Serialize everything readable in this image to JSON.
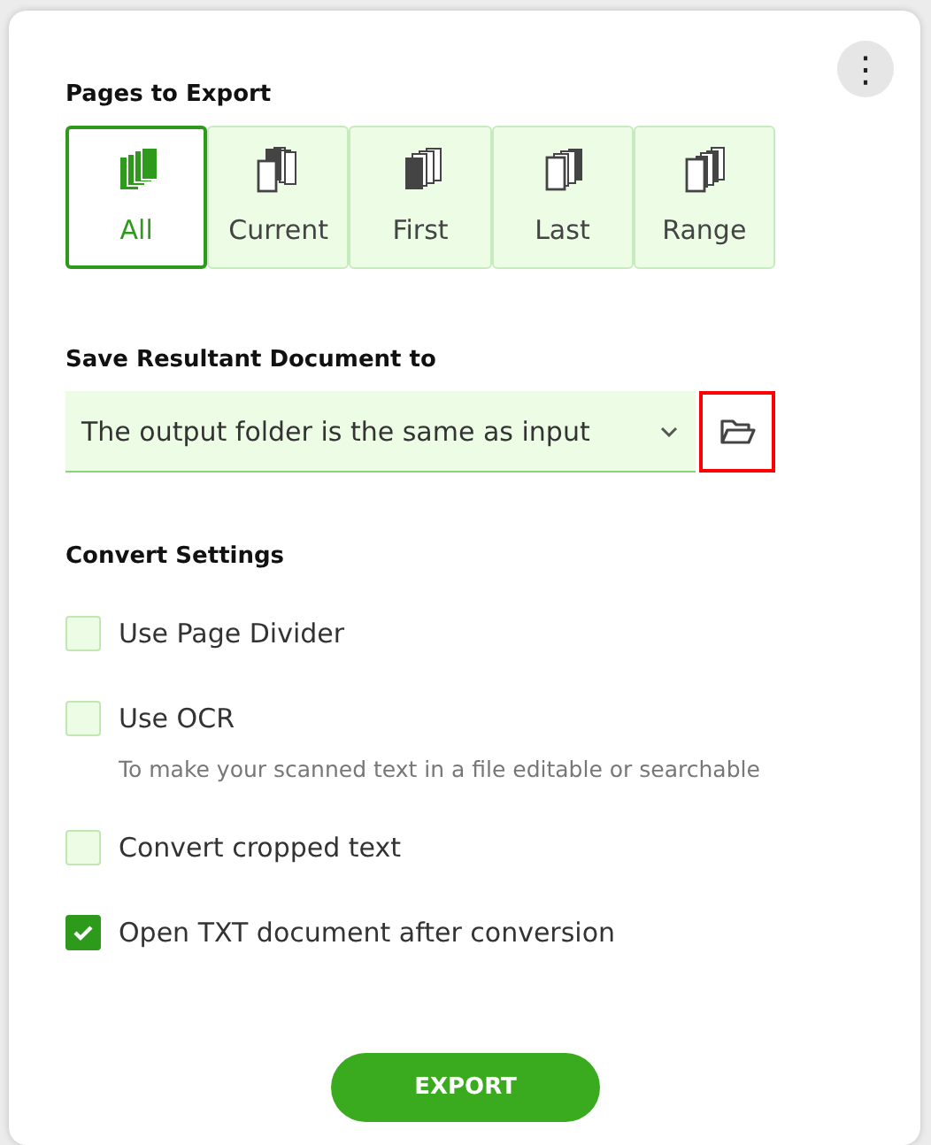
{
  "menu_button": {
    "label": "⋮"
  },
  "pages_section": {
    "title": "Pages to Export",
    "options": [
      {
        "label": "All",
        "kind": "all",
        "selected": true
      },
      {
        "label": "Current",
        "kind": "current",
        "selected": false
      },
      {
        "label": "First",
        "kind": "first",
        "selected": false
      },
      {
        "label": "Last",
        "kind": "last",
        "selected": false
      },
      {
        "label": "Range",
        "kind": "range",
        "selected": false
      }
    ]
  },
  "save_section": {
    "title": "Save Resultant Document to",
    "dropdown": {
      "value": "The output folder is the same as input"
    },
    "folder_button": {
      "highlighted": true
    }
  },
  "settings_section": {
    "title": "Convert Settings",
    "options": [
      {
        "label": "Use Page Divider",
        "checked": false
      },
      {
        "label": "Use OCR",
        "checked": false,
        "hint": "To make your scanned text in a file editable or searchable"
      },
      {
        "label": "Convert cropped text",
        "checked": false
      },
      {
        "label": "Open TXT document after conversion",
        "checked": true
      }
    ]
  },
  "export_button": {
    "label": "EXPORT"
  }
}
